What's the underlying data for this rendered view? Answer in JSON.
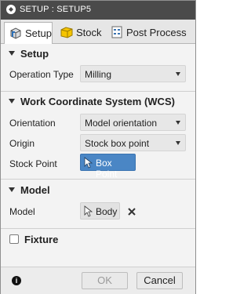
{
  "window": {
    "title": "SETUP : SETUP5"
  },
  "tabs": [
    {
      "label": "Setup",
      "icon": "setup-icon",
      "active": true
    },
    {
      "label": "Stock",
      "icon": "stock-box-icon",
      "active": false
    },
    {
      "label": "Post Process",
      "icon": "post-process-icon",
      "active": false
    }
  ],
  "setup_section": {
    "title": "Setup",
    "operation_type_label": "Operation Type",
    "operation_type_value": "Milling"
  },
  "wcs_section": {
    "title": "Work Coordinate System (WCS)",
    "orientation_label": "Orientation",
    "orientation_value": "Model orientation",
    "origin_label": "Origin",
    "origin_value": "Stock box point",
    "stock_point_label": "Stock Point",
    "stock_point_value": "Box Point"
  },
  "model_section": {
    "title": "Model",
    "model_label": "Model",
    "model_value": "Body"
  },
  "fixture_section": {
    "title": "Fixture",
    "checked": false
  },
  "footer": {
    "ok_label": "OK",
    "cancel_label": "Cancel",
    "info_icon": "info-icon"
  },
  "colors": {
    "titlebar": "#4a4a4a",
    "selection_blue": "#4a86c5",
    "panel": "#f3f3f3"
  }
}
